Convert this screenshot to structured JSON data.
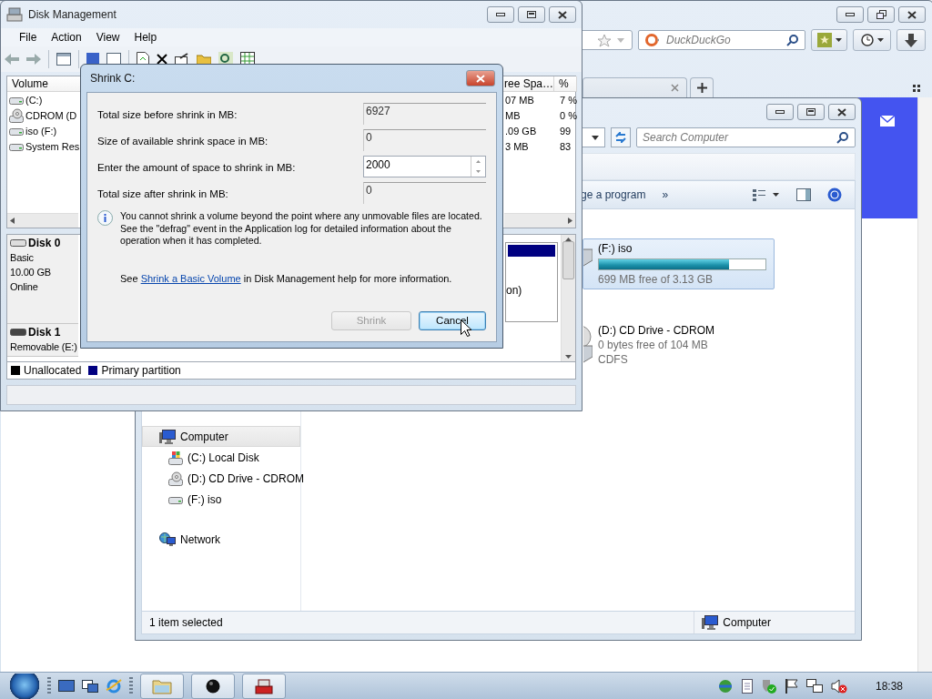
{
  "browser": {
    "search": {
      "placeholder": "DuckDuckGo"
    }
  },
  "explorer": {
    "search": {
      "placeholder": "Search Computer"
    },
    "toolbar": {
      "command": "ge a program",
      "more": "»"
    },
    "drives": [
      {
        "kind": "bar",
        "name": "(F:) iso",
        "selected": true,
        "level": 0.78,
        "free": "699 MB free of 3.13 GB"
      },
      {
        "kind": "plain",
        "name": "(D:) CD Drive - CDROM",
        "selected": false,
        "free": "0 bytes free of 104 MB",
        "filesystem": "CDFS"
      }
    ],
    "nav": [
      {
        "label": "Computer",
        "selected": true,
        "children": [
          {
            "label": "(C:) Local Disk",
            "selected": false
          },
          {
            "label": "(D:) CD Drive - CDROM",
            "selected": false
          },
          {
            "label": "(F:) iso",
            "selected": false
          }
        ]
      },
      {
        "label": "Network",
        "selected": false
      }
    ],
    "status": {
      "text": "1 item selected",
      "location": "Computer"
    }
  },
  "disk_management": {
    "title": "Disk Management",
    "menu": [
      "File",
      "Action",
      "View",
      "Help"
    ],
    "columns": [
      "Volume",
      "ree Spa…",
      "%"
    ],
    "rows": [
      {
        "cells": [
          "(C:)",
          "07 MB",
          "7 %"
        ]
      },
      {
        "cells": [
          "CDROM (D",
          "MB",
          "0 %"
        ]
      },
      {
        "cells": [
          "iso (F:)",
          ".09 GB",
          "99"
        ]
      },
      {
        "cells": [
          "System Res",
          "3 MB",
          "83"
        ]
      }
    ],
    "disks": [
      {
        "name": "Disk 0",
        "details": [
          "Basic",
          "10.00 GB",
          "Online"
        ]
      },
      {
        "name": "Disk 1",
        "details": [
          "Removable (E:)"
        ]
      }
    ],
    "partition_text": "on)",
    "legend": [
      {
        "label": "Unallocated",
        "color": "#000000"
      },
      {
        "label": "Primary partition",
        "color": "#000080"
      }
    ]
  },
  "dialog": {
    "title": "Shrink C:",
    "fields": [
      {
        "kind": "readonly",
        "label": "Total size before shrink in MB:",
        "value": "6927"
      },
      {
        "kind": "readonly",
        "label": "Size of available shrink space in MB:",
        "value": "0"
      },
      {
        "kind": "spin",
        "label": "Enter the amount of space to shrink in MB:",
        "value": "2000"
      },
      {
        "kind": "readonly",
        "label": "Total size after shrink in MB:",
        "value": "0"
      }
    ],
    "note": "You cannot shrink a volume beyond the point where any unmovable files are located. See the \"defrag\" event in the Application log for detailed information about the operation when it has completed.",
    "help": {
      "before": "See",
      "link": "Shrink a Basic Volume",
      "after": "in Disk Management help for more information."
    },
    "buttons": [
      {
        "label": "Shrink",
        "disabled": true,
        "focused": false
      },
      {
        "label": "Cancel",
        "disabled": false,
        "focused": true
      }
    ]
  },
  "taskbar": {
    "clock": "18:38"
  }
}
